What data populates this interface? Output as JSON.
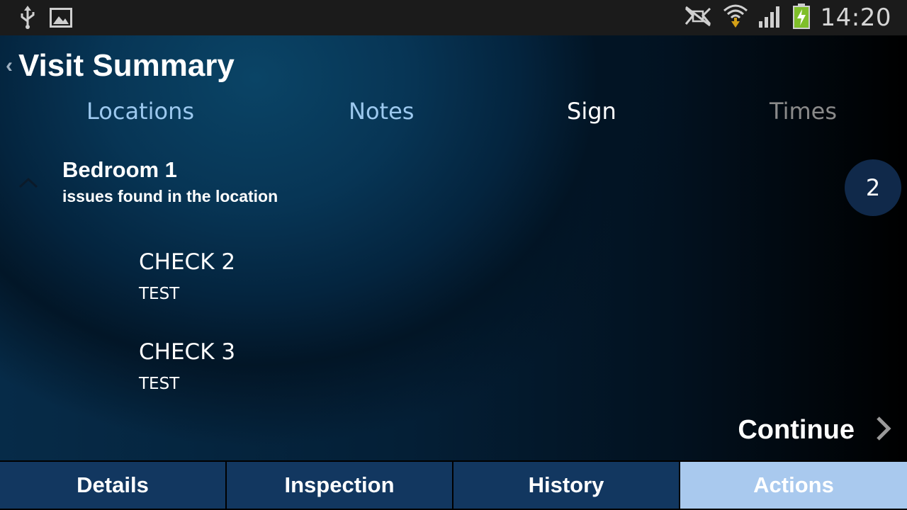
{
  "status_bar": {
    "time": "14:20",
    "icons": [
      "usb-icon",
      "image-icon",
      "nfc-icon",
      "wifi-icon",
      "signal-icon",
      "battery-charging-icon"
    ]
  },
  "header": {
    "title": "Visit Summary"
  },
  "tabs": [
    {
      "label": "Locations"
    },
    {
      "label": "Notes"
    },
    {
      "label": "Sign"
    },
    {
      "label": "Times"
    }
  ],
  "location": {
    "name": "Bedroom 1",
    "subtitle": "issues found in the location",
    "count": "2",
    "items": [
      {
        "title": "CHECK 2",
        "note": "TEST"
      },
      {
        "title": "CHECK 3",
        "note": "TEST"
      }
    ]
  },
  "continue": {
    "label": "Continue"
  },
  "bottom_nav": [
    {
      "label": "Details"
    },
    {
      "label": "Inspection"
    },
    {
      "label": "History"
    },
    {
      "label": "Actions"
    }
  ],
  "colors": {
    "active_nav": "#a9c9ee",
    "nav_bg": "#123760",
    "tab_accent": "#9cc8ee"
  }
}
